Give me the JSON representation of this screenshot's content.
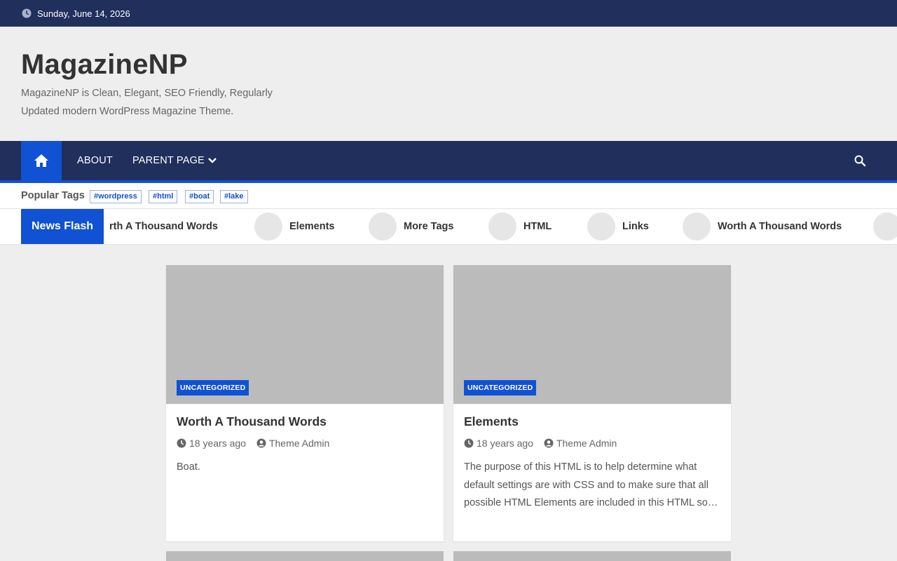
{
  "topbar": {
    "date": "Sunday, June 14, 2026"
  },
  "site": {
    "title": "MagazineNP",
    "description": "MagazineNP is Clean, Elegant, SEO Friendly, Regularly Updated modern WordPress Magazine Theme."
  },
  "nav": {
    "items": [
      {
        "label": "ABOUT"
      },
      {
        "label": "PARENT PAGE"
      }
    ]
  },
  "tags": {
    "title": "Popular Tags",
    "items": [
      "#wordpress",
      "#html",
      "#boat",
      "#lake"
    ]
  },
  "news_flash": {
    "label": "News Flash",
    "items": [
      "rth A Thousand Words",
      "Elements",
      "More Tags",
      "HTML",
      "Links",
      "Worth A Thousand Words"
    ]
  },
  "posts": [
    {
      "category": "UNCATEGORIZED",
      "title": "Worth A Thousand Words",
      "time": "18 years ago",
      "author": "Theme Admin",
      "excerpt": "Boat."
    },
    {
      "category": "UNCATEGORIZED",
      "title": "Elements",
      "time": "18 years ago",
      "author": "Theme Admin",
      "excerpt": "The purpose of this HTML is to help determine what default settings are with CSS and to make sure that all possible HTML Elements are included in this HTML so…"
    }
  ],
  "colors": {
    "navy": "#202f5b",
    "accent": "#1151d3",
    "thumb": "#bbbbbb"
  }
}
